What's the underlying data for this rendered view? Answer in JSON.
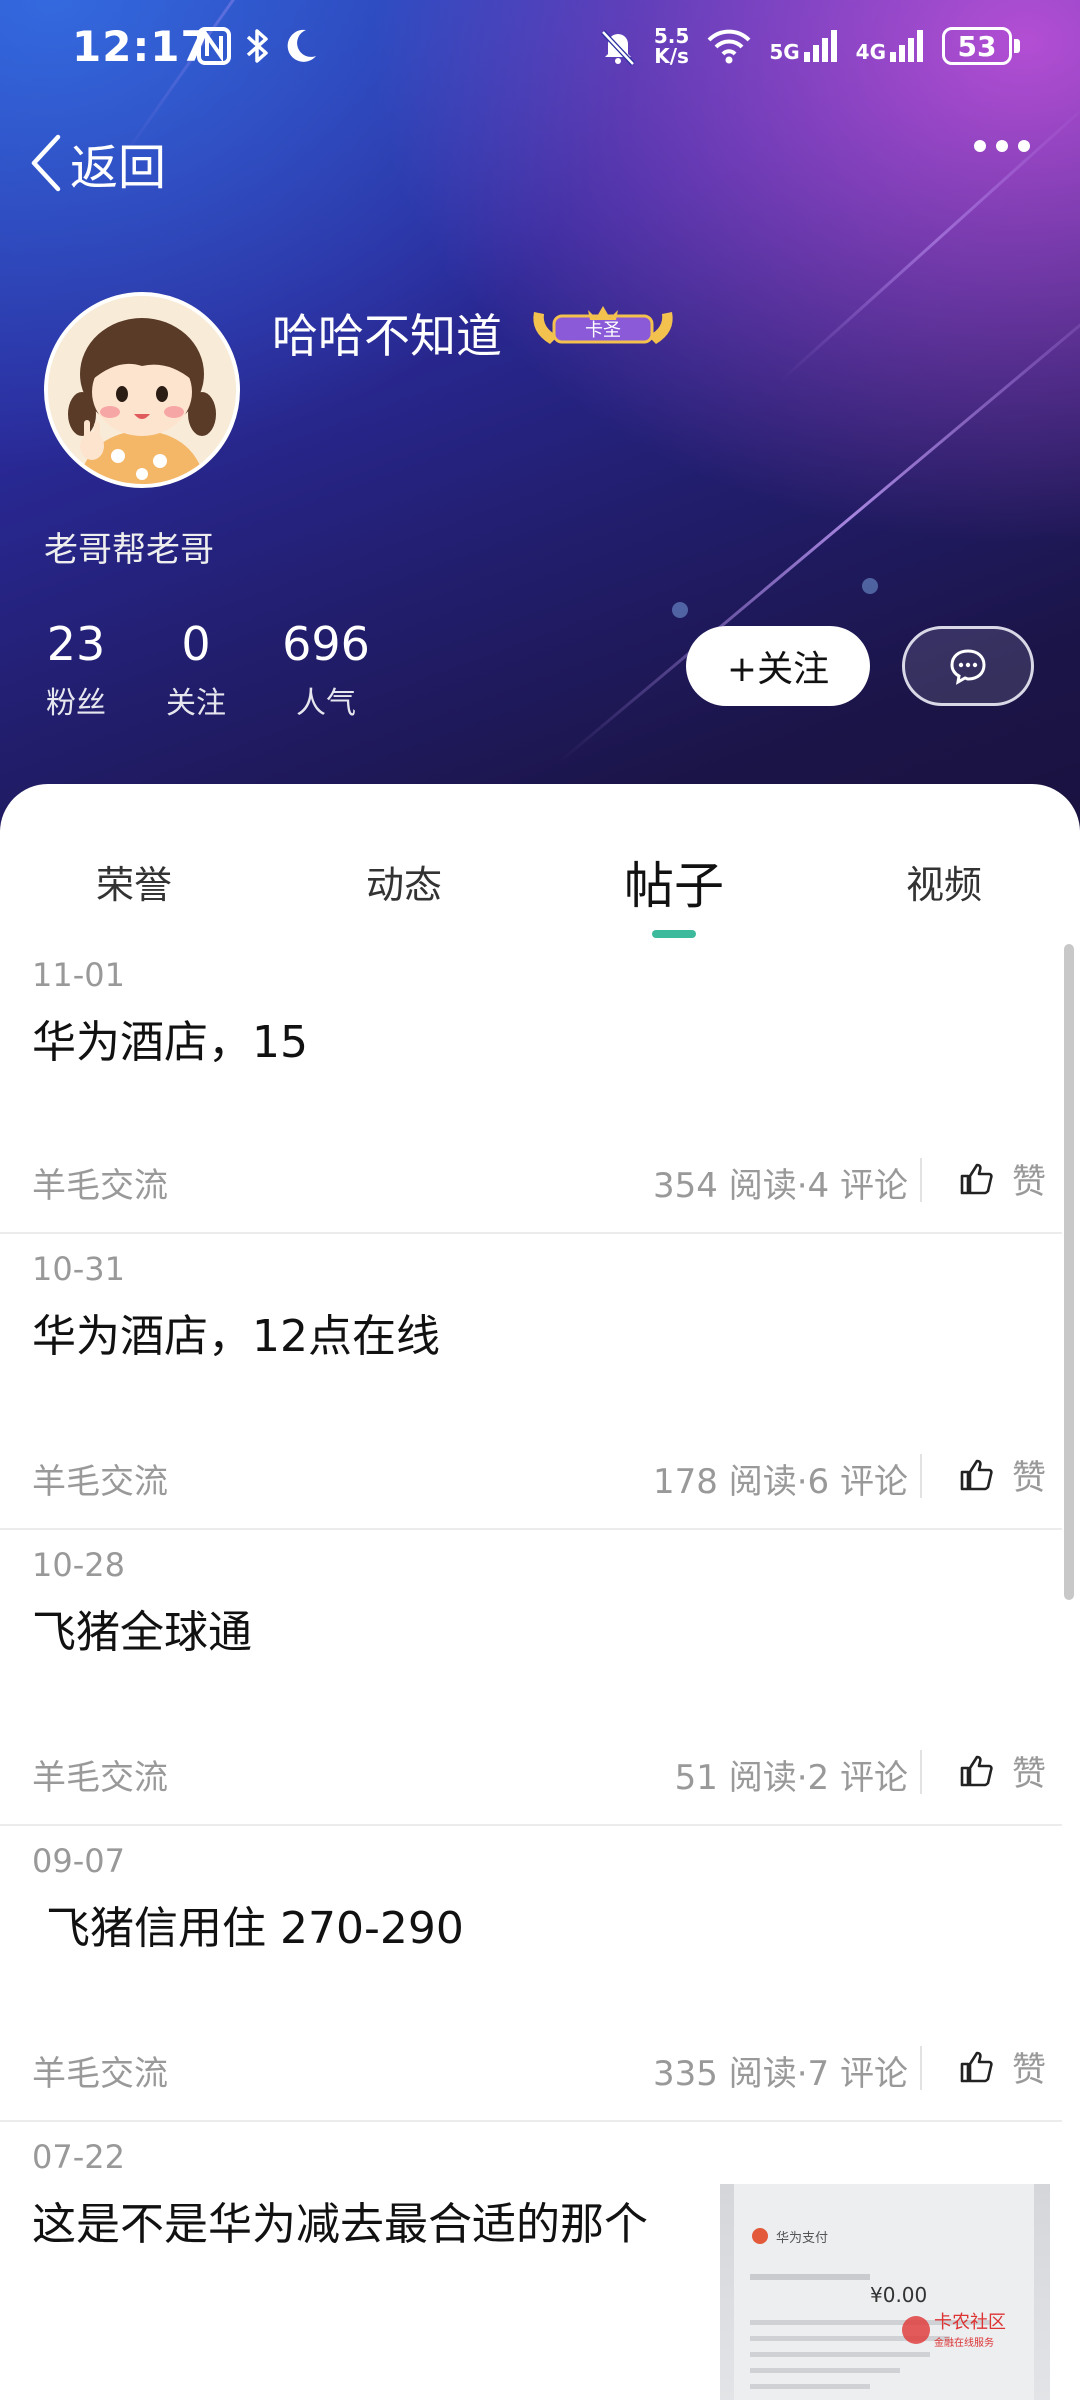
{
  "status_bar": {
    "time": "12:17",
    "left_icons": [
      "nfc-icon",
      "bluetooth-icon",
      "moon-icon"
    ],
    "net_speed_value": "5.5",
    "net_speed_unit": "K/s",
    "sig1_label": "5G",
    "sig2_label": "4G",
    "battery": "53"
  },
  "nav": {
    "back_label": "返回"
  },
  "profile": {
    "name": "哈哈不知道",
    "badge_text": "卡圣",
    "bio": "老哥帮老哥",
    "stats": [
      {
        "num": "23",
        "label": "粉丝"
      },
      {
        "num": "0",
        "label": "关注"
      },
      {
        "num": "696",
        "label": "人气"
      }
    ],
    "follow_label": "+关注"
  },
  "tabs": [
    {
      "label": "荣誉",
      "active": false
    },
    {
      "label": "动态",
      "active": false
    },
    {
      "label": "帖子",
      "active": true
    },
    {
      "label": "视频",
      "active": false
    }
  ],
  "accent_color": "#3dba9c",
  "posts": [
    {
      "date": "11-01",
      "title": "华为酒店，15",
      "category": "羊毛交流",
      "stats": "354 阅读·4 评论",
      "like": "赞"
    },
    {
      "date": "10-31",
      "title": "华为酒店，12点在线",
      "category": "羊毛交流",
      "stats": "178 阅读·6 评论",
      "like": "赞"
    },
    {
      "date": "10-28",
      "title": "飞猪全球通",
      "category": "羊毛交流",
      "stats": "51 阅读·2 评论",
      "like": "赞"
    },
    {
      "date": "09-07",
      "title": " 飞猪信用住 270-290",
      "category": "羊毛交流",
      "stats": "335 阅读·7 评论",
      "like": "赞"
    },
    {
      "date": "07-22",
      "title": "这是不是华为减去最合适的那个",
      "category": "",
      "stats": "",
      "like": ""
    }
  ],
  "thumbnail": {
    "heading": "华为支付",
    "amount": "¥0.00",
    "watermark_title": "卡农社区",
    "watermark_sub": "金融在线服务"
  }
}
